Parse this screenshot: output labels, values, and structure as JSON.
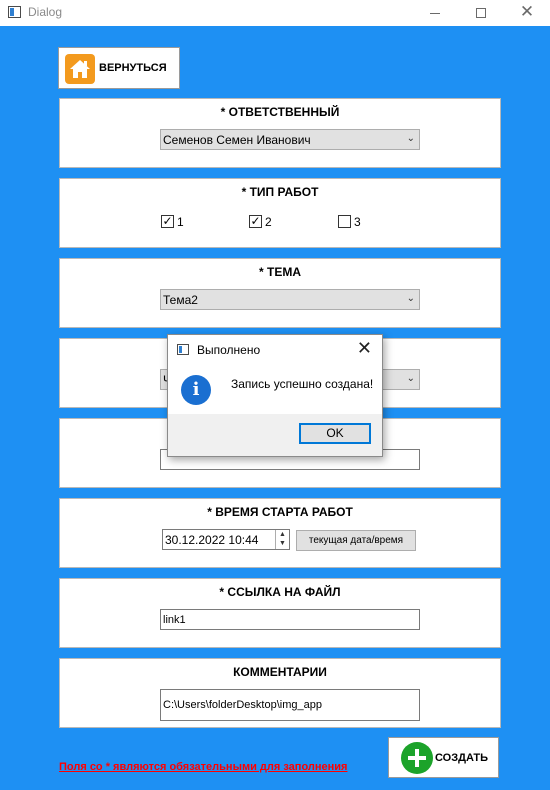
{
  "window": {
    "title": "Dialog"
  },
  "toolbar": {
    "back_label": "ВЕРНУТЬСЯ",
    "create_label": "СОЗДАТЬ"
  },
  "sections": {
    "responsible": {
      "title": "* ОТВЕТСТВЕННЫЙ",
      "selected": "Семенов Семен Иванович"
    },
    "work_type": {
      "title": "* ТИП РАБОТ",
      "options": [
        {
          "label": "1",
          "checked": true
        },
        {
          "label": "2",
          "checked": true
        },
        {
          "label": "3",
          "checked": false
        }
      ]
    },
    "topic": {
      "title": "* ТЕМА",
      "selected": "Тема2"
    },
    "hidden_combo": {
      "selected_partial": "Ч"
    },
    "start_time": {
      "title": "* ВРЕМЯ СТАРТА РАБОТ",
      "value": "30.12.2022 10:44",
      "now_button": "текущая дата/время"
    },
    "file_link": {
      "title": "* ССЫЛКА НА ФАЙЛ",
      "value": "link1"
    },
    "comments": {
      "title": "КОММЕНТАРИИ",
      "value": "C:\\Users\\folderDesktop\\img_app"
    }
  },
  "footer": {
    "required_note": "Поля со * являются обязательными для заполнения"
  },
  "message_box": {
    "title": "Выполнено",
    "text": "Запись успешно создана!",
    "ok_label": "OK"
  },
  "colors": {
    "background": "#1e90f3",
    "required_note": "#ff0000",
    "create_icon": "#1ca32a",
    "home_icon": "#f39a1e",
    "info_icon": "#1a6fd1"
  },
  "icons": {
    "back": "home-icon",
    "create": "plus-circle-icon",
    "message": "info-icon"
  }
}
